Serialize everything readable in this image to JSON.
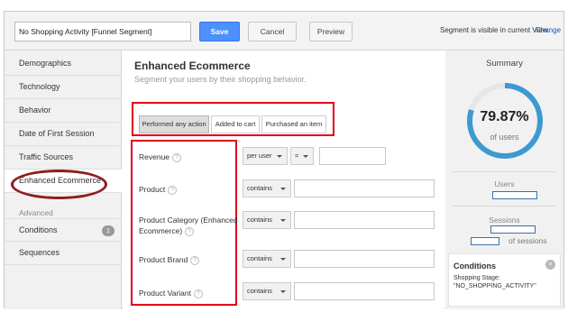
{
  "topbar": {
    "segment_name": "No Shopping Activity [Funnel Segment]",
    "save_label": "Save",
    "cancel_label": "Cancel",
    "preview_label": "Preview",
    "visibility_text": "Segment is visible in current View",
    "change_label": "Change"
  },
  "sidebar": {
    "items": [
      {
        "label": "Demographics"
      },
      {
        "label": "Technology"
      },
      {
        "label": "Behavior"
      },
      {
        "label": "Date of First Session"
      },
      {
        "label": "Traffic Sources"
      },
      {
        "label": "Enhanced Ecommerce"
      }
    ],
    "advanced_heading": "Advanced",
    "advanced_items": [
      {
        "label": "Conditions",
        "badge": "1"
      },
      {
        "label": "Sequences"
      }
    ]
  },
  "main": {
    "title": "Enhanced Ecommerce",
    "subtitle": "Segment your users by their shopping behavior.",
    "tabs": [
      {
        "label": "Performed any action",
        "selected": true
      },
      {
        "label": "Added to cart",
        "selected": false
      },
      {
        "label": "Purchased an item",
        "selected": false
      }
    ],
    "help_glyph": "?",
    "fields": [
      {
        "label": "Revenue",
        "scope": "per user",
        "operator": "="
      },
      {
        "label": "Product",
        "operator": "contains"
      },
      {
        "label": "Product Category (Enhanced Ecommerce)",
        "operator": "contains"
      },
      {
        "label": "Product Brand",
        "operator": "contains"
      },
      {
        "label": "Product Variant",
        "operator": "contains"
      }
    ]
  },
  "summary": {
    "title": "Summary",
    "percent": "79.87%",
    "percent_value": 0.7987,
    "percent_caption": "of users",
    "users_label": "Users",
    "sessions_label": "Sessions",
    "sessions_caption": "of sessions",
    "conditions_title": "Conditions",
    "conditions_detail": "Shopping Stage: \"NO_SHOPPING_ACTIVITY\"",
    "close_glyph": "×"
  },
  "colors": {
    "accent": "#4d90fe",
    "ring": "#3d9ad1",
    "highlight_box": "#e0001b",
    "oval": "#8e1d1d"
  }
}
